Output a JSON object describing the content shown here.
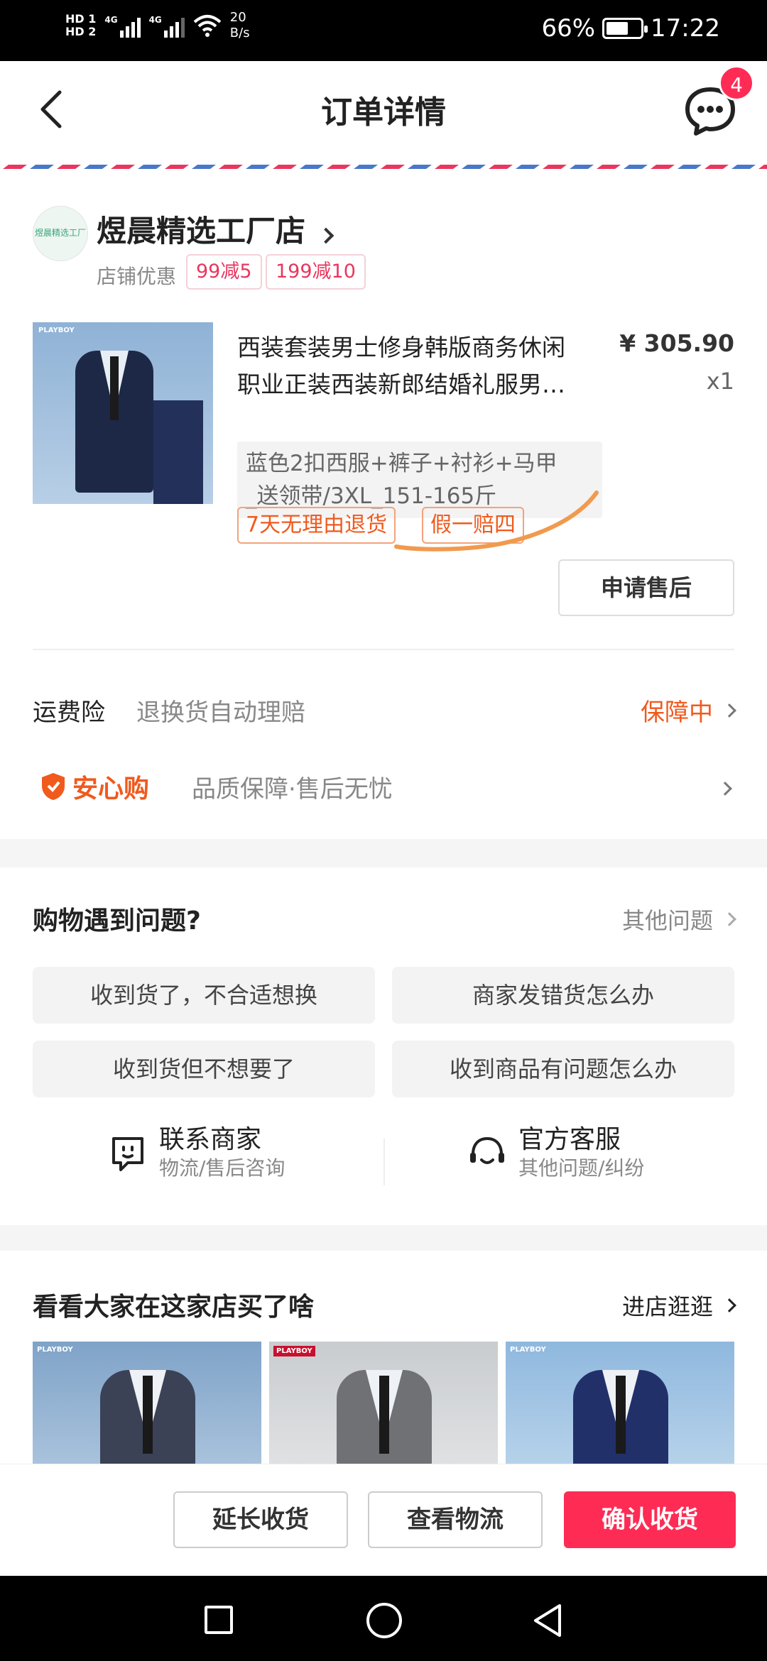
{
  "status_bar": {
    "sim1": "HD 1",
    "sim2": "HD 2",
    "net1": "4G",
    "net2": "4G",
    "speed_value": "20",
    "speed_unit": "B/s",
    "battery_text": "66%",
    "battery_level": 0.66,
    "time": "17:22"
  },
  "header": {
    "title": "订单详情",
    "message_badge": "4"
  },
  "shop": {
    "name": "煜晨精选工厂店",
    "logo_text": "煜晨精选工厂",
    "promo_label": "店铺优惠",
    "coupons": [
      "99减5",
      "199减10"
    ]
  },
  "product": {
    "image_logo": "PLAYBOY",
    "title_line1": "西装套装男士修身韩版商务休闲",
    "title_line2": "职业正装西装新郎结婚礼服男…",
    "price": "¥ 305.90",
    "quantity": "x1",
    "sku_line1": "蓝色2扣西服+裤子+衬衫+马甲",
    "sku_line2": "_送领带/3XL_151-165斤",
    "tags": [
      "7天无理由退货",
      "假一赔四"
    ],
    "after_sale_button": "申请售后"
  },
  "freight": {
    "label": "运费险",
    "desc": "退换货自动理赔",
    "status": "保障中"
  },
  "anxin": {
    "brand": "安心购",
    "desc": "品质保障·售后无忧"
  },
  "problems": {
    "title": "购物遇到问题?",
    "other": "其他问题",
    "questions": [
      "收到货了，不合适想换",
      "商家发错货怎么办",
      "收到货但不想要了",
      "收到商品有问题怎么办"
    ],
    "contact_seller": {
      "title": "联系商家",
      "sub": "物流/售后咨询"
    },
    "official_service": {
      "title": "官方客服",
      "sub": "其他问题/纠纷"
    }
  },
  "recommend": {
    "title": "看看大家在这家店买了啥",
    "more": "进店逛逛",
    "items": [
      {
        "logo": "PLAYBOY",
        "color": "#3b4256"
      },
      {
        "logo": "PLAYBOY",
        "color": "#6f7175"
      },
      {
        "logo": "PLAYBOY",
        "color": "#22306a"
      }
    ]
  },
  "bottom_bar": {
    "extend": "延长收货",
    "logistics": "查看物流",
    "confirm": "确认收货"
  },
  "colors": {
    "accent": "#fe2c55",
    "orange": "#f05a1d",
    "coupon": "#e8375e"
  }
}
